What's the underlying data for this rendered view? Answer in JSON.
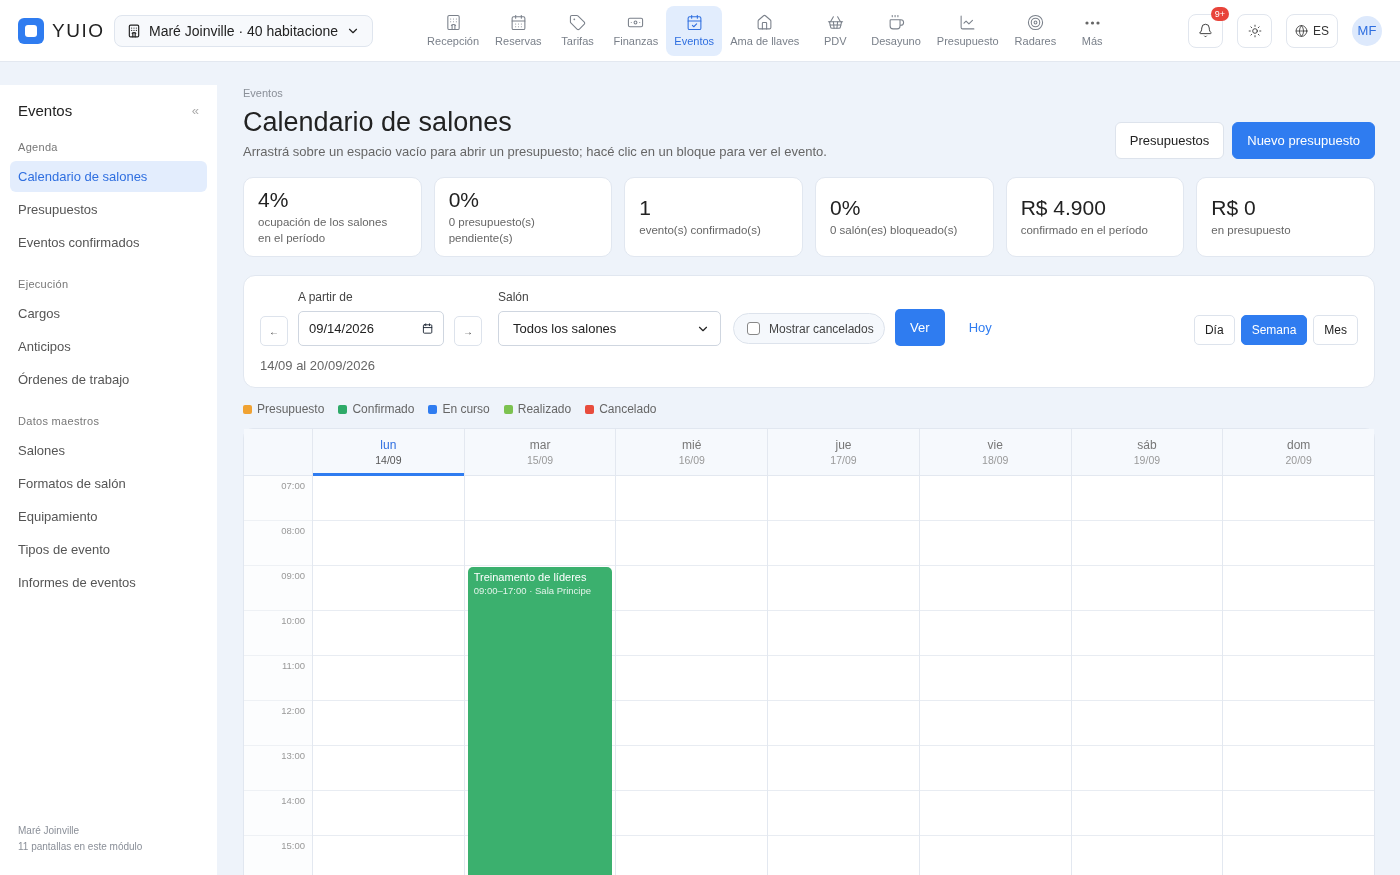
{
  "header": {
    "logo": "YUIO",
    "property": "Maré Joinville · 40 habitacione",
    "nav": [
      {
        "label": "Recepción",
        "selected": false
      },
      {
        "label": "Reservas",
        "selected": false
      },
      {
        "label": "Tarifas",
        "selected": false
      },
      {
        "label": "Finanzas",
        "selected": false
      },
      {
        "label": "Eventos",
        "selected": true
      },
      {
        "label": "Ama de llaves",
        "selected": false
      },
      {
        "label": "PDV",
        "selected": false
      },
      {
        "label": "Desayuno",
        "selected": false
      },
      {
        "label": "Presupuesto",
        "selected": false
      },
      {
        "label": "Radares",
        "selected": false
      },
      {
        "label": "Más",
        "selected": false
      }
    ],
    "notifications": "9+",
    "language": "ES",
    "avatar": "MF"
  },
  "sidebar": {
    "title": "Eventos",
    "collapse": "«",
    "sections": [
      {
        "title": "Agenda",
        "items": [
          {
            "label": "Calendario de salones",
            "selected": true
          },
          {
            "label": "Presupuestos",
            "selected": false
          },
          {
            "label": "Eventos confirmados",
            "selected": false
          }
        ]
      },
      {
        "title": "Ejecución",
        "items": [
          {
            "label": "Cargos",
            "selected": false
          },
          {
            "label": "Anticipos",
            "selected": false
          },
          {
            "label": "Órdenes de trabajo",
            "selected": false
          }
        ]
      },
      {
        "title": "Datos maestros",
        "items": [
          {
            "label": "Salones",
            "selected": false
          },
          {
            "label": "Formatos de salón",
            "selected": false
          },
          {
            "label": "Equipamiento",
            "selected": false
          },
          {
            "label": "Tipos de evento",
            "selected": false
          },
          {
            "label": "Informes de eventos",
            "selected": false
          }
        ]
      }
    ],
    "footer": [
      "Maré Joinville",
      "11 pantallas en este módulo"
    ]
  },
  "page": {
    "breadcrumb": "Eventos",
    "title": "Calendario de salones",
    "subtitle": "Arrastrá sobre un espacio vacío para abrir un presupuesto; hacé clic en un bloque para ver el evento.",
    "buttons": [
      {
        "label": "Presupuestos",
        "kind": "secondary"
      },
      {
        "label": "Nuevo presupuesto",
        "kind": "primary"
      }
    ]
  },
  "stats": [
    {
      "value": "4%",
      "label": [
        "ocupación de los salones",
        "en el período"
      ]
    },
    {
      "value": "0%",
      "label": [
        "0 presupuesto(s)",
        "pendiente(s)"
      ]
    },
    {
      "value": "1",
      "label": [
        "evento(s) confirmado(s)"
      ]
    },
    {
      "value": "0%",
      "label": [
        "0 salón(es) bloqueado(s)"
      ]
    },
    {
      "value": "R$ 4.900",
      "label": [
        "confirmado en el período"
      ]
    },
    {
      "value": "R$ 0",
      "label": [
        "en presupuesto"
      ]
    }
  ],
  "filters": {
    "prev": "←",
    "next": "→",
    "date_label": "A partir de",
    "date": "09/14/2026",
    "room_label": "Salón",
    "room": "Todos los salones",
    "show_cancelled": {
      "label": "Mostrar cancelados",
      "checked": false
    },
    "apply": "Ver",
    "today": "Hoy",
    "range": "14/09 al 20/09/2026",
    "views": [
      {
        "label": "Día",
        "selected": false
      },
      {
        "label": "Semana",
        "selected": true
      },
      {
        "label": "Mes",
        "selected": false
      }
    ]
  },
  "legend": [
    {
      "label": "Presupuesto",
      "color": "#f0a232"
    },
    {
      "label": "Confirmado",
      "color": "#2eaa68"
    },
    {
      "label": "En curso",
      "color": "#2f7cf0"
    },
    {
      "label": "Realizado",
      "color": "#7cc250"
    },
    {
      "label": "Cancelado",
      "color": "#e84c3c"
    }
  ],
  "calendar": {
    "times": [
      "07:00",
      "08:00",
      "09:00",
      "10:00",
      "11:00",
      "12:00",
      "13:00",
      "14:00",
      "15:00"
    ],
    "days": [
      {
        "name": "lun",
        "date": "14/09",
        "selected": true
      },
      {
        "name": "mar",
        "date": "15/09",
        "selected": false,
        "events": [
          {
            "title": "Treinamento de líderes",
            "start": "09:00",
            "dash": "–",
            "end": "17:00",
            "room": "· Sala Principe",
            "color": "#3bb06e"
          }
        ]
      },
      {
        "name": "mié",
        "date": "16/09",
        "selected": false
      },
      {
        "name": "jue",
        "date": "17/09",
        "selected": false
      },
      {
        "name": "vie",
        "date": "18/09",
        "selected": false
      },
      {
        "name": "sáb",
        "date": "19/09",
        "selected": false
      },
      {
        "name": "dom",
        "date": "20/09",
        "selected": false
      }
    ]
  }
}
